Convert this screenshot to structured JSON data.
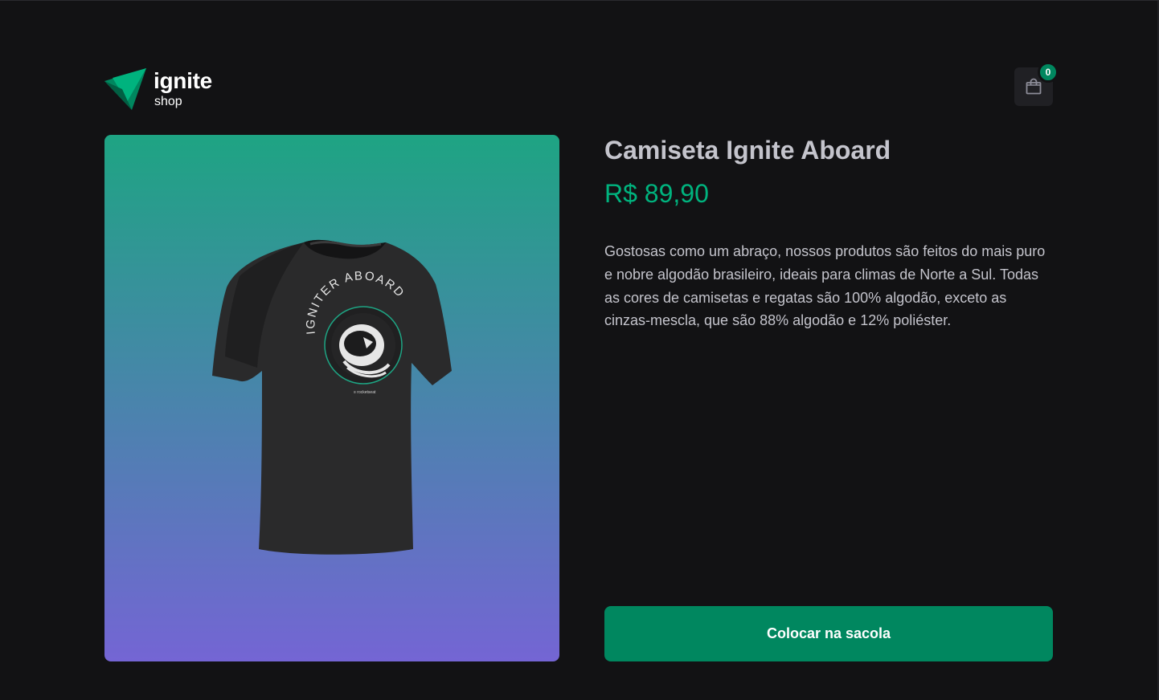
{
  "header": {
    "logo_word": "ignite",
    "logo_sub": "shop",
    "cart_count": "0"
  },
  "product": {
    "title": "Camiseta Ignite Aboard",
    "price": "R$ 89,90",
    "description": "Gostosas como um abraço, nossos produtos são feitos do mais puro e nobre algodão brasileiro, ideais para climas de Norte a Sul. Todas as cores de camisetas e regatas são 100% algodão, exceto as cinzas-mescla, que são 88% algodão e 12% poliéster.",
    "image": {
      "print_text_main": "IGNITER",
      "print_text_sub": "ABOARD",
      "print_brand": "rocketseat"
    }
  },
  "actions": {
    "add_to_bag_label": "Colocar na sacola"
  },
  "colors": {
    "background": "#121214",
    "surface": "#202024",
    "brand": "#00875f",
    "price": "#00b37e",
    "gradient_top": "#1ea483",
    "gradient_bottom": "#7465d4"
  },
  "icons": {
    "cart": "shopping-bag-icon",
    "logo": "ignite-logo-icon"
  }
}
